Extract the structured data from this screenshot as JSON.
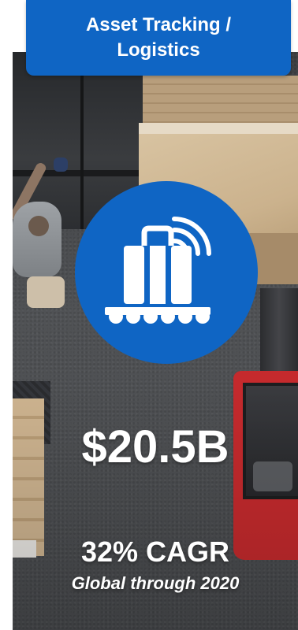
{
  "header": {
    "title_line1": "Asset Tracking /",
    "title_line2": "Logistics"
  },
  "icon": {
    "name": "luggage-conveyor-wireless-icon",
    "disc_color": "#0f65c4",
    "glyph_color": "#ffffff"
  },
  "stats": {
    "market_value": "$20.5B",
    "growth_rate": "32% CAGR",
    "growth_scope": "Global through 2020"
  },
  "colors": {
    "accent_blue": "#0f65c4",
    "text": "#ffffff"
  }
}
